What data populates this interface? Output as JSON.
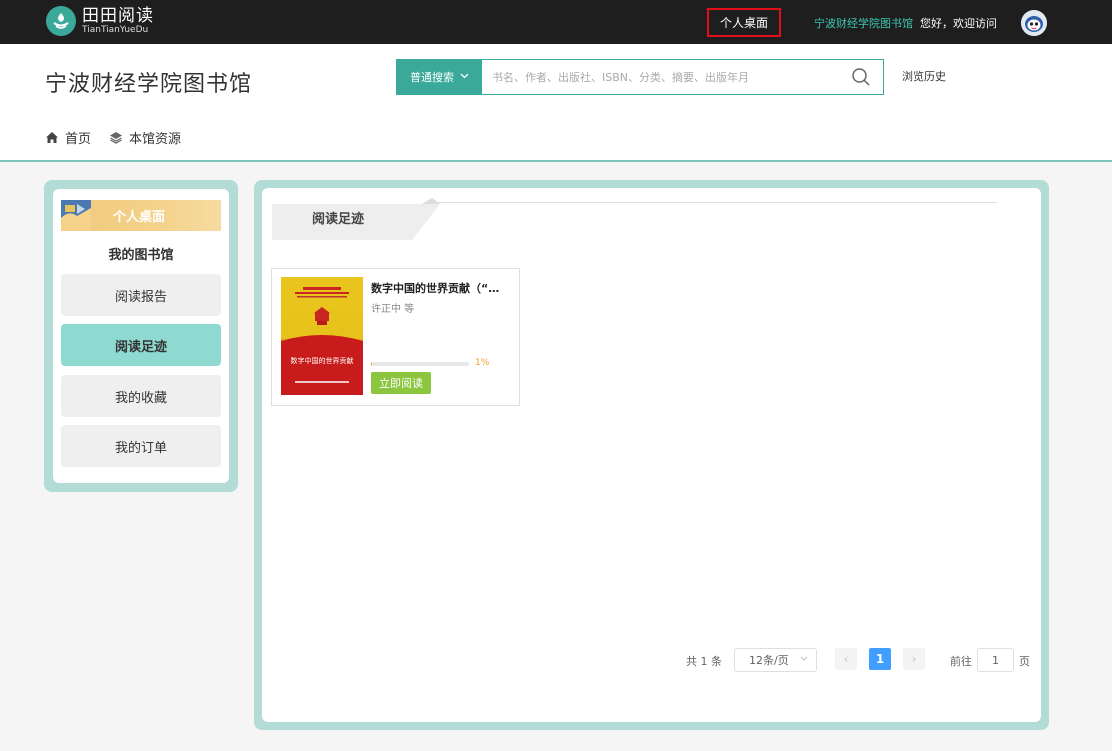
{
  "topbar": {
    "logo_cn": "田田阅读",
    "logo_en": "TianTianYueDu",
    "desk_link": "个人桌面",
    "library_link": "宁波财经学院图书馆",
    "greeting": "您好，欢迎访问"
  },
  "header": {
    "site_title": "宁波财经学院图书馆",
    "search": {
      "type_label": "普通搜索",
      "placeholder": "书名、作者、出版社、ISBN、分类、摘要、出版年月",
      "value": ""
    },
    "history_link": "浏览历史",
    "breadcrumb": [
      "首页",
      "本馆资源"
    ]
  },
  "sidebar": {
    "banner_title": "个人桌面",
    "subtitle": "我的图书馆",
    "items": [
      {
        "label": "阅读报告",
        "active": false
      },
      {
        "label": "阅读足迹",
        "active": true
      },
      {
        "label": "我的收藏",
        "active": false
      },
      {
        "label": "我的订单",
        "active": false
      }
    ]
  },
  "main": {
    "tab_label": "阅读足迹",
    "books": [
      {
        "title": "数字中国的世界贡献（“…",
        "author": "许正中 等",
        "cover_title": "数字中国的世界贡献",
        "progress": 1,
        "progress_label": "1%",
        "read_button": "立即阅读"
      }
    ],
    "pagination": {
      "total": "共 1 条",
      "page_size": "12条/页",
      "prev": "‹",
      "current": "1",
      "next": "›",
      "goto_label": "前往",
      "goto_value": "1",
      "page_unit": "页"
    }
  },
  "colors": {
    "accent": "#3aa99a",
    "active_item": "#8ed9d0",
    "panel_border": "#b4dcd6",
    "read_button": "#8cc63f",
    "progress": "#f0a030",
    "pager_current": "#409eff"
  }
}
